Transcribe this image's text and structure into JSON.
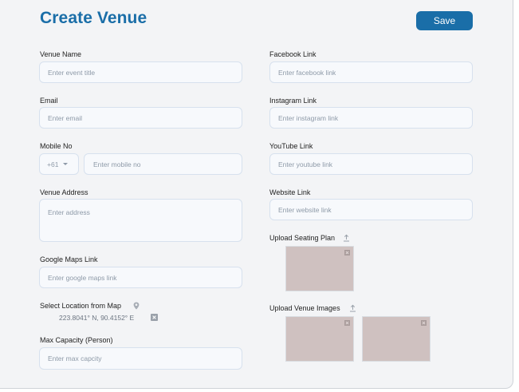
{
  "page": {
    "title": "Create Venue",
    "save_label": "Save"
  },
  "left": {
    "venue_name": {
      "label": "Venue Name",
      "placeholder": "Enter event title"
    },
    "email": {
      "label": "Email",
      "placeholder": "Enter email"
    },
    "mobile": {
      "label": "Mobile No",
      "country_code": "+61",
      "placeholder": "Enter mobile no"
    },
    "address": {
      "label": "Venue Address",
      "placeholder": "Enter address"
    },
    "maps_link": {
      "label": "Google Maps Link",
      "placeholder": "Enter google maps link"
    },
    "location": {
      "label": "Select Location from Map",
      "coordinates": "223.8041° N, 90.4152° E"
    },
    "capacity": {
      "label": "Max Capacity (Person)",
      "placeholder": "Enter max capcity"
    }
  },
  "right": {
    "facebook": {
      "label": "Facebook Link",
      "placeholder": "Enter facebook link"
    },
    "instagram": {
      "label": "Instagram Link",
      "placeholder": "Enter instagram link"
    },
    "youtube": {
      "label": "YouTube Link",
      "placeholder": "Enter youtube link"
    },
    "website": {
      "label": "Website Link",
      "placeholder": "Enter website link"
    },
    "seating_plan": {
      "label": "Upload Seating Plan"
    },
    "venue_images": {
      "label": "Upload Venue Images"
    }
  },
  "icons": {
    "upload": "upload-icon",
    "location_pin": "location-pin-icon",
    "remove": "close-icon"
  },
  "colors": {
    "accent": "#1a6ea8",
    "panel_background": "#f3f4f6",
    "input_background": "#f7f9fc",
    "input_border": "#d7e1ee",
    "thumbnail": "#cfc1c0"
  }
}
